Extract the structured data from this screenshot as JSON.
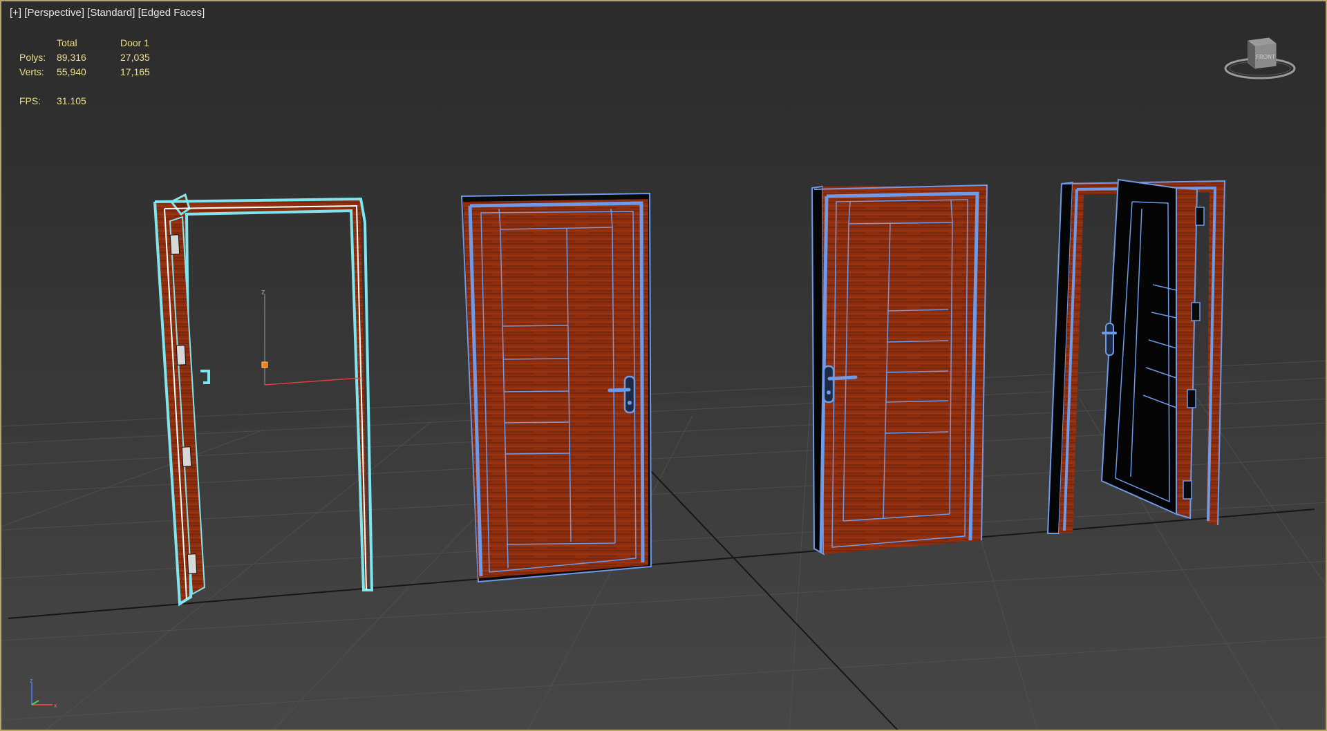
{
  "viewport": {
    "labels": [
      "[+]",
      "[Perspective]",
      "[Standard]",
      "[Edged Faces]"
    ],
    "stats": {
      "header_total": "Total",
      "header_object": "Door 1",
      "polys_label": "Polys:",
      "polys_total": "89,316",
      "polys_object": "27,035",
      "verts_label": "Verts:",
      "verts_total": "55,940",
      "verts_object": "17,165",
      "fps_label": "FPS:",
      "fps_value": "31.105"
    },
    "viewcube": {
      "face_label": "FRONT"
    },
    "gizmo": {
      "z_label": "z"
    },
    "axis_tripod": {
      "z_label": "z",
      "x_label": "x"
    },
    "colors": {
      "frame_border": "#b8a56a",
      "stats_text": "#ece08a",
      "selection_outline": "#7fe6f0",
      "wire_outline": "#6f9ae8",
      "wood": "#8f2e0e"
    }
  }
}
